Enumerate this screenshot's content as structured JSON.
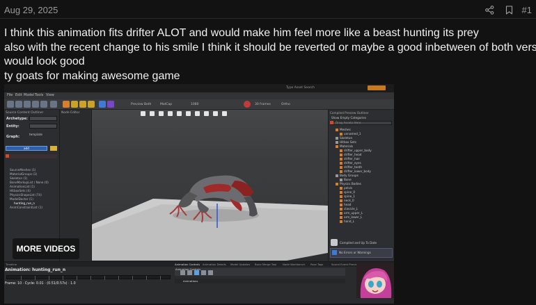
{
  "post": {
    "date": "Aug 29, 2025",
    "number": "#1",
    "lines": [
      "I think this animation fits drifter ALOT and would make him feel more like a beast hunting its prey",
      "also with the recent change to his smile I think it should be reverted or maybe a good inbetween of both versions",
      "would look good",
      "ty goats for making awesome game"
    ]
  },
  "header_icons": [
    "share-icon",
    "bookmark-icon"
  ],
  "video": {
    "overlay_button": "MORE VIDEOS",
    "editor": {
      "menu": [
        "File",
        "Edit",
        "Model",
        "Tools",
        "View"
      ],
      "search_label": "Type Asset Search",
      "toolbar_labels": [
        "Preview Both",
        "MatCap",
        "1080",
        "30 frames",
        "Ortho"
      ],
      "left_panel": {
        "title": "Source Content Outliner",
        "sub_title": "Node Editor",
        "archetype_label": "Archetype:",
        "entity_label": "Entity:",
        "graph_label": "Graph:",
        "graph_value": "template",
        "add_button": "add",
        "items": [
          "SourceMeshes (1)",
          "MaterialGroups (3)",
          "Skeleton (1)",
          "BoneMarkupList / None (0)",
          "AnimationList (1)",
          "HitboxSets (4)",
          "PhysicsShapeList (74)",
          "ModelDoctor (1)",
          "hunting_run_n",
          "AnimConstraintList (1)"
        ]
      },
      "right_panel": {
        "title": "Compiled Preview Outliner",
        "show_empty": "Show Empty Categories",
        "search": "Drag Assets Here",
        "items": [
          "Meshes",
          "unnamed_1",
          "Skeleton",
          "Hitbox Sets",
          "Materials",
          "drifter_upper_body",
          "drifter_head",
          "drifter_hair",
          "drifter_eyes",
          "drifter_teeth",
          "drifter_lower_body",
          "Body Groups",
          "Bone",
          "Physics Bodies",
          "pelvis",
          "spine_0",
          "spine_1",
          "neck_0",
          "head",
          "clavicle_L",
          "arm_upper_L",
          "arm_lower_L",
          "hand_L"
        ],
        "compiled_status": "Compiled and Up To Date",
        "errors_status": "No Errors or Warnings"
      },
      "bottom": {
        "tabs": [
          "Timeline",
          "Animation Controls",
          "Animation Details",
          "Model Updates",
          "Bone Merge Tool",
          "Node Workbench",
          "Pose Tags",
          "Sound Event Preview Tool"
        ],
        "animation_label": "Animation: hunting_run_n",
        "frame_readout": "Frame: 10 · Cycle: 0.01 · (0.51/0.57s) · 1.0",
        "animations_row": "Animations",
        "controls_title": "Animation Controls"
      }
    }
  },
  "colors": {
    "background": "#121212",
    "text": "#f0f0f0",
    "muted": "#9a9a9a",
    "editor_accent": "#3f7ad6",
    "orange_toolbar": "#d97e2a"
  }
}
